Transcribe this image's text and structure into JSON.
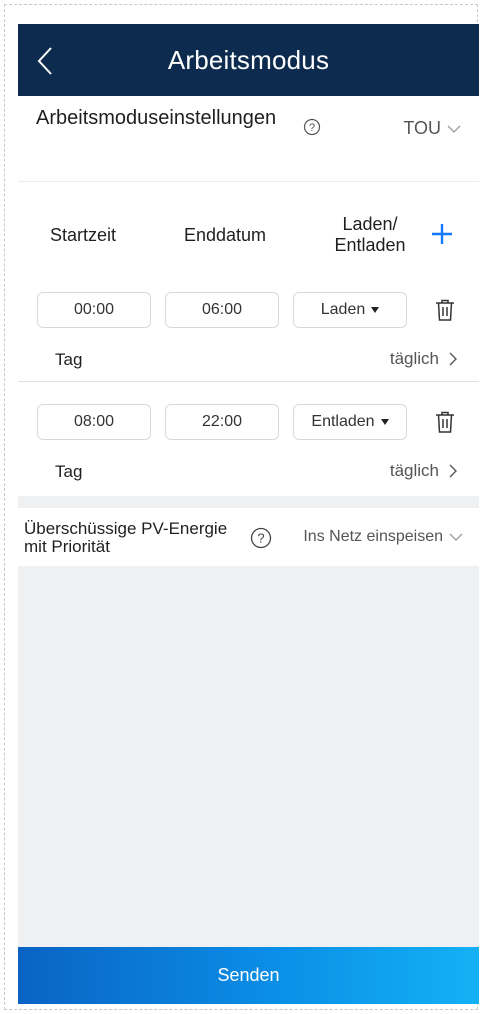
{
  "header": {
    "title": "Arbeitsmodus",
    "back_icon": "chevron-left-icon"
  },
  "mode": {
    "label": "Arbeitsmoduseinstellungen",
    "value": "TOU"
  },
  "columns": {
    "start": "Startzeit",
    "end": "Enddatum",
    "mode": "Laden/ Entladen"
  },
  "schedules": [
    {
      "start": "00:00",
      "end": "06:00",
      "mode": "Laden",
      "tag_label": "Tag",
      "repeat": "täglich"
    },
    {
      "start": "08:00",
      "end": "22:00",
      "mode": "Entladen",
      "tag_label": "Tag",
      "repeat": "täglich"
    }
  ],
  "surplus": {
    "label": "Überschüssige PV-Energie mit Priorität",
    "value": "Ins Netz einspeisen"
  },
  "footer": {
    "send_label": "Senden"
  },
  "colors": {
    "header_bg": "#0c2b4e",
    "accent": "#1677ff",
    "page_bg": "#eef0f2"
  }
}
